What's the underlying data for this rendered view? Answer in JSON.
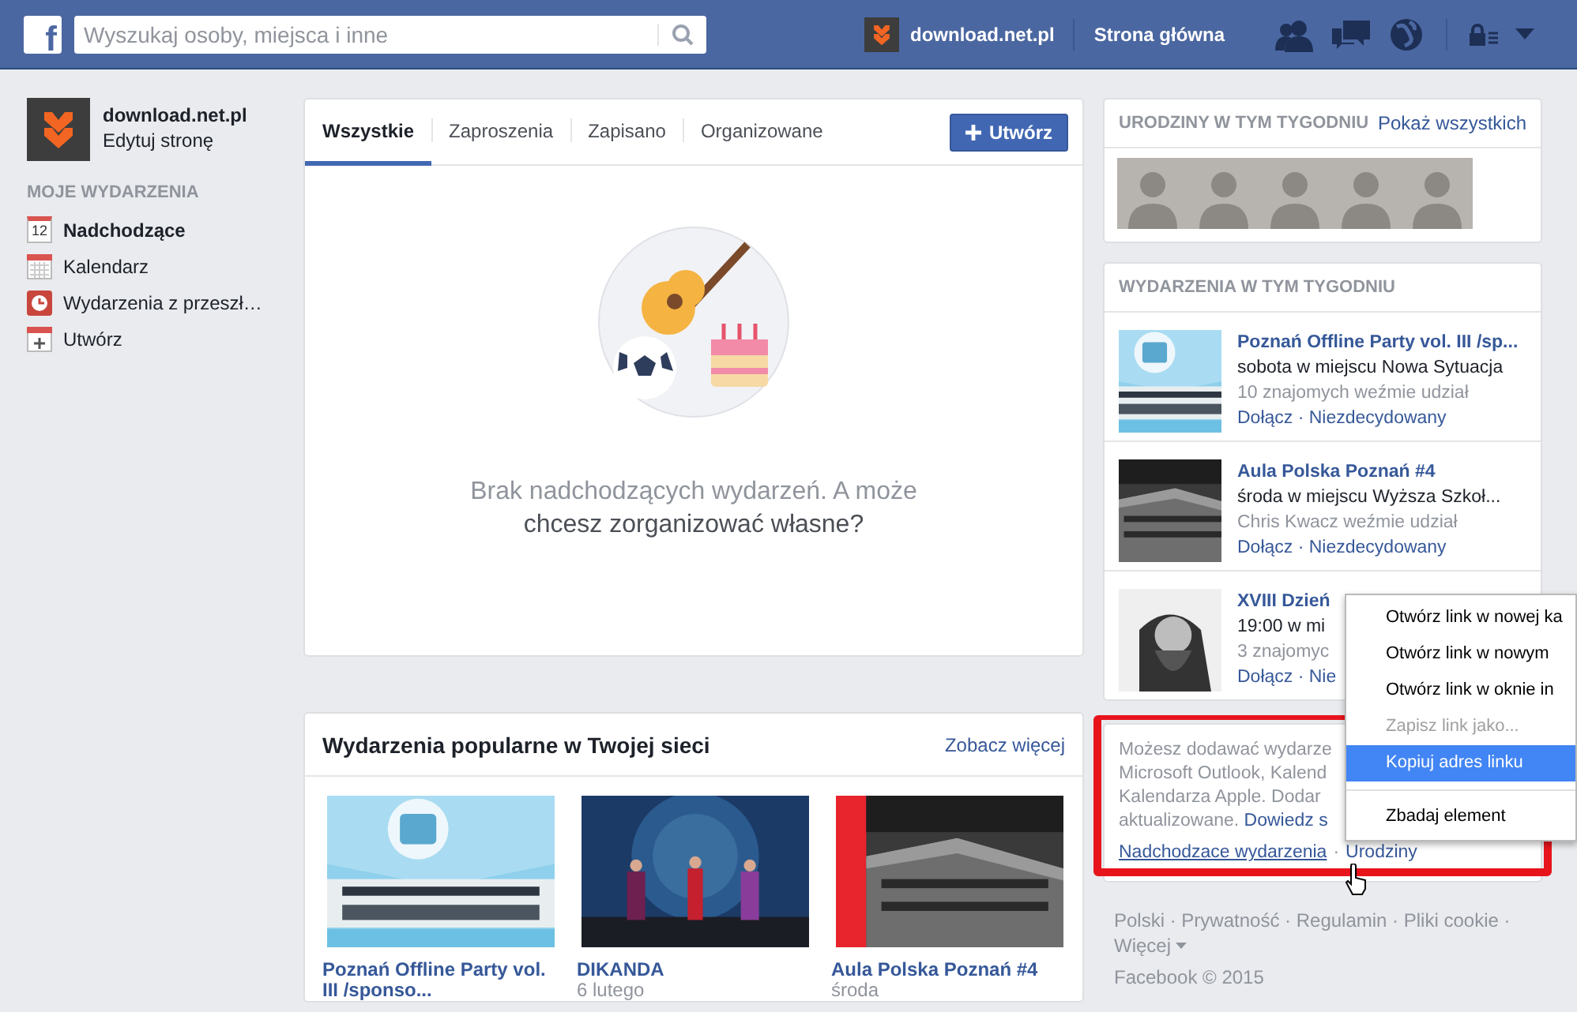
{
  "topbar": {
    "logo": "f",
    "search": {
      "placeholder": "Wyszukaj osoby, miejsca i inne"
    },
    "page_name": "download.net.pl",
    "home": "Strona główna"
  },
  "sidebar": {
    "page": {
      "name": "download.net.pl",
      "action": "Edytuj stronę"
    },
    "section": "MOJE WYDARZENIA",
    "items": [
      {
        "kind": "day",
        "badge": "12",
        "label": "Nadchodzące",
        "selected": true
      },
      {
        "kind": "calendar",
        "label": "Kalendarz",
        "selected": false
      },
      {
        "kind": "clock",
        "label": "Wydarzenia z przeszł…",
        "selected": false
      },
      {
        "kind": "create",
        "label": "Utwórz",
        "selected": false
      }
    ]
  },
  "events": {
    "tabs": [
      {
        "label": "Wszystkie",
        "selected": true
      },
      {
        "label": "Zaproszenia",
        "selected": false
      },
      {
        "label": "Zapisano",
        "selected": false
      },
      {
        "label": "Organizowane",
        "selected": false
      }
    ],
    "create_button": "Utwórz",
    "empty_message": "Brak nadchodzących wydarzeń. A może",
    "empty_link": "chcesz zorganizować własne?"
  },
  "popular": {
    "title": "Wydarzenia popularne w Twojej sieci",
    "more": "Zobacz więcej",
    "cards": [
      {
        "title": "Poznań Offline Party vol. III /sponso...",
        "kind": "poster"
      },
      {
        "title": "DIKANDA",
        "date": "6 lutego",
        "kind": "stage"
      },
      {
        "title": "Aula Polska Poznań #4",
        "date": "środa",
        "kind": "building"
      }
    ]
  },
  "birthdays": {
    "title": "URODZINY W TYM TYGODNIU",
    "link": "Pokaż wszystkich",
    "avatars": [
      {
        "kind": "avatar"
      },
      {
        "kind": "avatar"
      },
      {
        "kind": "avatar"
      },
      {
        "kind": "avatar"
      },
      {
        "kind": "avatar"
      }
    ]
  },
  "week_events": {
    "title": "WYDARZENIA W TYM TYGODNIU",
    "items": [
      {
        "kind": "poster",
        "title": "Poznań Offline Party vol. III /sp...",
        "when": "sobota w miejscu Nowa Sytuacja",
        "friends": "10 znajomych weźmie udział",
        "actions": "Dołącz · Niezdecydowany"
      },
      {
        "kind": "building",
        "title": "Aula Polska Poznań #4",
        "when": "środa w miejscu Wyższa Szkoł...",
        "friends": "Chris Kwacz weźmie udział",
        "actions": "Dołącz · Niezdecydowany"
      },
      {
        "kind": "portrait",
        "title": "XVIII Dzień",
        "when": "19:00 w mi",
        "friends": "3 znajomyc",
        "actions": "Dołącz · Nie"
      }
    ]
  },
  "export_info": {
    "lines": [
      "Możesz dodawać wydarze",
      "Microsoft Outlook, Kalend",
      "Kalendarza Apple. Dodar"
    ],
    "last_line": "aktualizowane.",
    "learn_link": "Dowiedz s",
    "links": [
      {
        "label": "Nadchodzace wydarzenia",
        "hovered": true
      },
      {
        "label": "Urodziny",
        "hovered": false
      }
    ],
    "separator": "·"
  },
  "footer": {
    "links": "Polski · Prywatność · Regulamin · Pliki cookie ·",
    "more": "Więcej",
    "copyright": "Facebook © 2015"
  },
  "context_menu": {
    "items": [
      {
        "kind": "item",
        "label": "Otwórz link w nowej ka",
        "disabled": false,
        "selected": false
      },
      {
        "kind": "item",
        "label": "Otwórz link w nowym",
        "disabled": false,
        "selected": false
      },
      {
        "kind": "item",
        "label": "Otwórz link w oknie in",
        "disabled": false,
        "selected": false
      },
      {
        "kind": "item",
        "label": "Zapisz link jako...",
        "disabled": true,
        "selected": false
      },
      {
        "kind": "item",
        "label": "Kopiuj adres linku",
        "disabled": false,
        "selected": true
      },
      {
        "kind": "separator"
      },
      {
        "kind": "item",
        "label": "Zbadaj element",
        "disabled": false,
        "selected": false
      }
    ]
  }
}
